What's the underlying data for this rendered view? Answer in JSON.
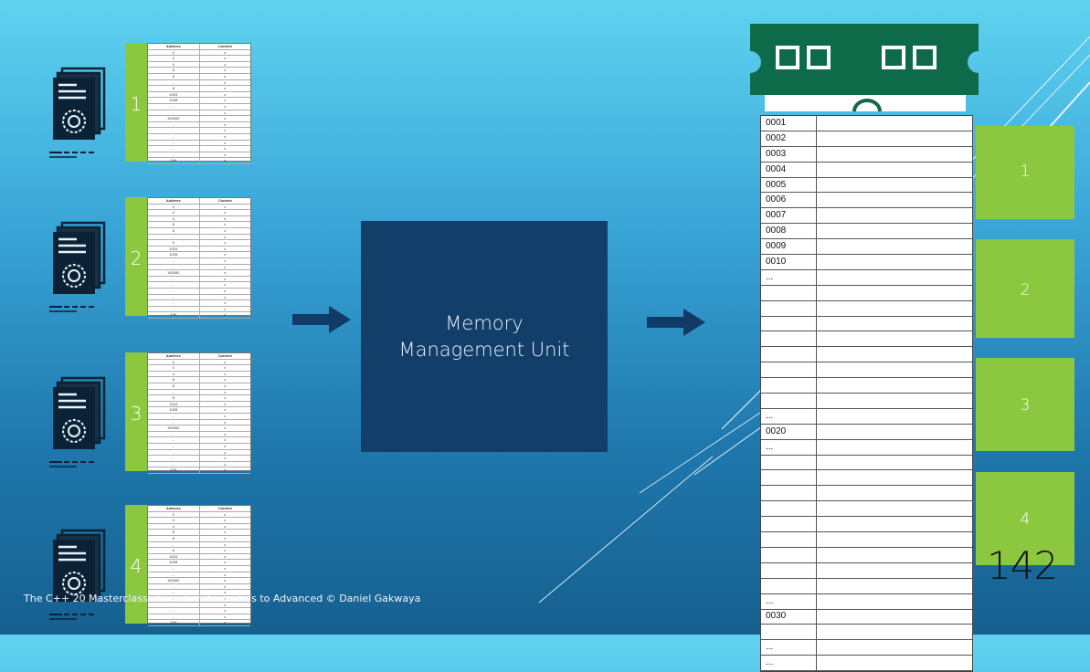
{
  "programs": [
    {
      "number": "1"
    },
    {
      "number": "2"
    },
    {
      "number": "3"
    },
    {
      "number": "4"
    }
  ],
  "page_table": {
    "headers": [
      "Address",
      "Content"
    ],
    "rows": [
      [
        "0",
        "x"
      ],
      [
        "0",
        "x"
      ],
      [
        "4",
        "x"
      ],
      [
        "8",
        "x"
      ],
      [
        "8",
        "x"
      ],
      [
        "...",
        "x"
      ],
      [
        "8",
        "x"
      ],
      [
        "1024",
        "x"
      ],
      [
        "1028",
        "x"
      ],
      [
        "...",
        "x"
      ],
      [
        "...",
        "x"
      ],
      [
        "100000",
        "x"
      ],
      [
        "...",
        "x"
      ],
      [
        "...",
        "x"
      ],
      [
        "...",
        "x"
      ],
      [
        "...",
        "x"
      ],
      [
        "...",
        "x"
      ],
      [
        "...",
        "x"
      ],
      [
        "2^N",
        "x"
      ]
    ]
  },
  "mmu": {
    "line1": "Memory",
    "line2": "Management Unit"
  },
  "memory": {
    "rows": [
      "0001",
      "0002",
      "0003",
      "0004",
      "0005",
      "0006",
      "0007",
      "0008",
      "0009",
      "0010",
      "...",
      "",
      "",
      "",
      "",
      "",
      "",
      "",
      "",
      "...",
      "0020",
      "...",
      "",
      "",
      "",
      "",
      "",
      "",
      "",
      "",
      "",
      "...",
      "0030",
      "",
      "...",
      "..."
    ]
  },
  "frames": [
    "1",
    "2",
    "3",
    "4"
  ],
  "page_number": "142",
  "footer": "The C++ 20 Masterclass : From Fundamentals to Advanced   © Daniel Gakwaya",
  "colors": {
    "green": "#8bc83f",
    "mmu": "#123f6a",
    "ram": "#0d6b4a"
  },
  "icons": [
    "document-gear-icon",
    "arrow-right-icon",
    "ram-chip-icon"
  ]
}
